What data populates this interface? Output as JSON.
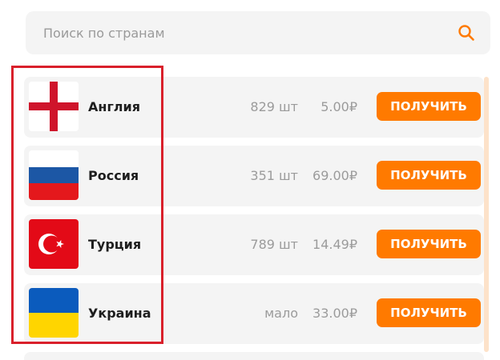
{
  "search": {
    "placeholder": "Поиск по странам",
    "icon": "search-icon"
  },
  "accent_color": "#ff7a00",
  "highlight_color": "#d9202b",
  "countries": [
    {
      "flag": "england-flag-icon",
      "name": "Англия",
      "qty": "829 шт",
      "price": "5.00₽",
      "button": "ПОЛУЧИТЬ"
    },
    {
      "flag": "russia-flag-icon",
      "name": "Россия",
      "qty": "351 шт",
      "price": "69.00₽",
      "button": "ПОЛУЧИТЬ"
    },
    {
      "flag": "turkey-flag-icon",
      "name": "Турция",
      "qty": "789 шт",
      "price": "14.49₽",
      "button": "ПОЛУЧИТЬ"
    },
    {
      "flag": "ukraine-flag-icon",
      "name": "Украина",
      "qty": "мало",
      "price": "33.00₽",
      "button": "ПОЛУЧИТЬ"
    }
  ]
}
